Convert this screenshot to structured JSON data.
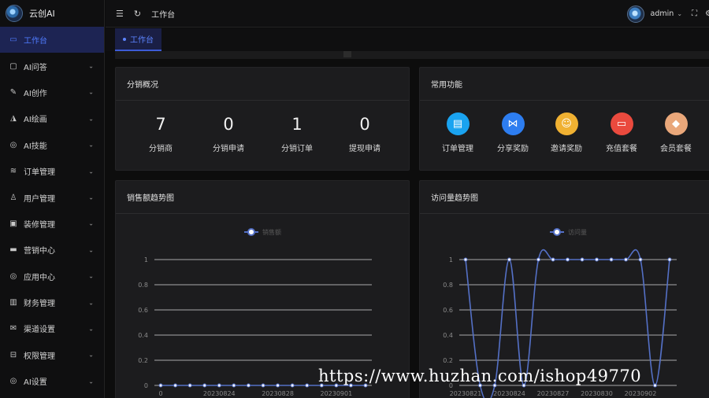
{
  "app": {
    "name": "云创AI"
  },
  "header": {
    "title": "工作台",
    "username": "admin"
  },
  "sidebar": {
    "items": [
      {
        "label": "工作台",
        "icon": "monitor-icon",
        "active": true
      },
      {
        "label": "AI问答",
        "icon": "chat-icon"
      },
      {
        "label": "AI创作",
        "icon": "pen-icon"
      },
      {
        "label": "AI绘画",
        "icon": "brush-icon"
      },
      {
        "label": "AI技能",
        "icon": "compass-icon"
      },
      {
        "label": "订单管理",
        "icon": "database-icon"
      },
      {
        "label": "用户管理",
        "icon": "user-icon"
      },
      {
        "label": "装修管理",
        "icon": "palette-icon"
      },
      {
        "label": "营销中心",
        "icon": "briefcase-icon"
      },
      {
        "label": "应用中心",
        "icon": "compass-icon"
      },
      {
        "label": "财务管理",
        "icon": "bar-chart-icon"
      },
      {
        "label": "渠道设置",
        "icon": "mail-icon"
      },
      {
        "label": "权限管理",
        "icon": "lock-icon"
      },
      {
        "label": "AI设置",
        "icon": "compass-icon"
      }
    ]
  },
  "tabs": [
    {
      "label": "工作台",
      "active": true
    }
  ],
  "distribution": {
    "title": "分销概况",
    "stats": [
      {
        "value": "7",
        "label": "分销商"
      },
      {
        "value": "0",
        "label": "分销申请"
      },
      {
        "value": "1",
        "label": "分销订单"
      },
      {
        "value": "0",
        "label": "提现申请"
      }
    ]
  },
  "functions": {
    "title": "常用功能",
    "items": [
      {
        "label": "订单管理",
        "icon": "clipboard-icon",
        "color": "#1aa3f0"
      },
      {
        "label": "分享奖励",
        "icon": "share-icon",
        "color": "#2d7df0"
      },
      {
        "label": "邀请奖励",
        "icon": "invite-icon",
        "color": "#f0b132"
      },
      {
        "label": "充值套餐",
        "icon": "card-icon",
        "color": "#ea4a3e"
      },
      {
        "label": "会员套餐",
        "icon": "diamond-icon",
        "color": "#e9a77a"
      }
    ]
  },
  "charts": {
    "sales": {
      "title": "销售额趋势图"
    },
    "visits": {
      "title": "访问量趋势图"
    }
  },
  "chart_data": [
    {
      "type": "line",
      "title": "销售额趋势图",
      "legend": "销售额",
      "legend_position": "top-center",
      "ylim": [
        0,
        1
      ],
      "yticks": [
        "0",
        "0.2",
        "0.4",
        "0.6",
        "0.8",
        "1"
      ],
      "xtick_labels": [
        "0",
        "20230824",
        "20230828",
        "20230901"
      ],
      "grid": true,
      "series": [
        {
          "name": "销售额",
          "values": [
            0,
            0,
            0,
            0,
            0,
            0,
            0,
            0,
            0,
            0,
            0,
            0,
            0,
            0,
            0
          ]
        }
      ],
      "color": "#5470c6"
    },
    {
      "type": "line",
      "title": "访问量趋势图",
      "legend": "访问量",
      "legend_position": "top-center",
      "ylim": [
        0,
        1
      ],
      "yticks": [
        "0",
        "0.2",
        "0.4",
        "0.6",
        "0.8",
        "1"
      ],
      "xtick_labels": [
        "20230821",
        "20230824",
        "20230827",
        "20230830",
        "20230902"
      ],
      "grid": true,
      "series": [
        {
          "name": "访问量",
          "values": [
            1,
            0,
            0,
            1,
            0,
            1,
            1,
            1,
            1,
            1,
            1,
            1,
            1,
            0,
            1
          ]
        }
      ],
      "color": "#5470c6"
    }
  ],
  "watermark": "https://www.huzhan.com/ishop49770"
}
